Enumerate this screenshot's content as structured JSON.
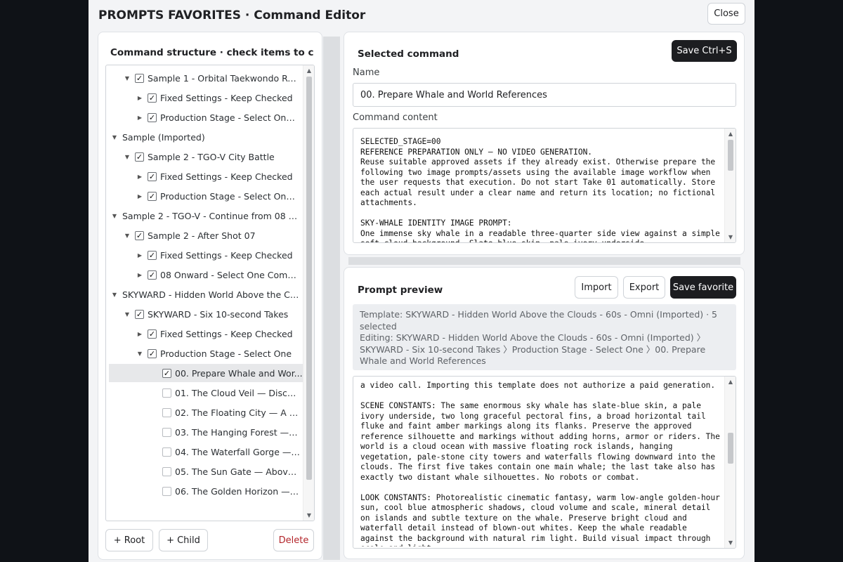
{
  "header": {
    "title": "PROMPTS FAVORITES · Command Editor",
    "close_label": "Close"
  },
  "structure": {
    "title": "Command structure · check items to combine",
    "items": [
      {
        "label": "Sample 1 - Orbital Taekwondo Ro...",
        "depth": 1,
        "caret": "down",
        "checkbox": "checked"
      },
      {
        "label": "Fixed Settings - Keep Checked",
        "depth": 2,
        "caret": "right",
        "checkbox": "checked"
      },
      {
        "label": "Production Stage - Select One,...",
        "depth": 2,
        "caret": "right",
        "checkbox": "checked"
      },
      {
        "label": "Sample (Imported)",
        "depth": 0,
        "caret": "down",
        "checkbox": "none"
      },
      {
        "label": "Sample 2 - TGO-V City Battle",
        "depth": 1,
        "caret": "down",
        "checkbox": "checked"
      },
      {
        "label": "Fixed Settings - Keep Checked",
        "depth": 2,
        "caret": "right",
        "checkbox": "checked"
      },
      {
        "label": "Production Stage - Select One,...",
        "depth": 2,
        "caret": "right",
        "checkbox": "checked"
      },
      {
        "label": "Sample 2 - TGO-V - Continue from 08 (...",
        "depth": 0,
        "caret": "down",
        "checkbox": "none"
      },
      {
        "label": "Sample 2 - After Shot 07",
        "depth": 1,
        "caret": "down",
        "checkbox": "checked"
      },
      {
        "label": "Fixed Settings - Keep Checked",
        "depth": 2,
        "caret": "right",
        "checkbox": "checked"
      },
      {
        "label": "08 Onward - Select One Comp...",
        "depth": 2,
        "caret": "right",
        "checkbox": "checked"
      },
      {
        "label": "SKYWARD - Hidden World Above the Cl...",
        "depth": 0,
        "caret": "down",
        "checkbox": "none"
      },
      {
        "label": "SKYWARD - Six 10-second Takes",
        "depth": 1,
        "caret": "down",
        "checkbox": "checked"
      },
      {
        "label": "Fixed Settings - Keep Checked",
        "depth": 2,
        "caret": "right",
        "checkbox": "checked"
      },
      {
        "label": "Production Stage - Select One",
        "depth": 2,
        "caret": "down",
        "checkbox": "checked"
      },
      {
        "label": "00. Prepare Whale and Wor...",
        "depth": 3,
        "caret": "none",
        "checkbox": "checked",
        "selected": true
      },
      {
        "label": "01. The Cloud Veil — Disco...",
        "depth": 3,
        "caret": "none",
        "checkbox": "unchecked"
      },
      {
        "label": "02. The Floating City — A P...",
        "depth": 3,
        "caret": "none",
        "checkbox": "unchecked"
      },
      {
        "label": "03. The Hanging Forest — ...",
        "depth": 3,
        "caret": "none",
        "checkbox": "unchecked"
      },
      {
        "label": "04. The Waterfall Gorge — ...",
        "depth": 3,
        "caret": "none",
        "checkbox": "unchecked"
      },
      {
        "label": "05. The Sun Gate — Above...",
        "depth": 3,
        "caret": "none",
        "checkbox": "unchecked"
      },
      {
        "label": "06. The Golden Horizon — ...",
        "depth": 3,
        "caret": "none",
        "checkbox": "unchecked"
      }
    ],
    "add_root_label": "+ Root",
    "add_child_label": "+ Child",
    "delete_label": "Delete"
  },
  "selected_command": {
    "title": "Selected command",
    "save_label": "Save  Ctrl+S",
    "name_label": "Name",
    "name_value": "00. Prepare Whale and World References",
    "content_label": "Command content",
    "content": "SELECTED_STAGE=00\nREFERENCE PREPARATION ONLY — NO VIDEO GENERATION.\nReuse suitable approved assets if they already exist. Otherwise prepare the following two image prompts/assets using the available image workflow when the user requests that execution. Do not start Take 01 automatically. Store each actual result under a clear name and return its location; no fictional attachments.\n\nSKY-WHALE IDENTITY IMAGE PROMPT:\nOne immense sky whale in a readable three-quarter side view against a simple soft cloud background. Slate-blue skin, pale ivory underside."
  },
  "preview": {
    "title": "Prompt preview",
    "import_label": "Import",
    "export_label": "Export",
    "save_favorite_label": "Save favorite",
    "template_line": "Template: SKYWARD - Hidden World Above the Clouds - 60s - Omni (Imported) · 5 selected",
    "editing_line": "Editing: SKYWARD - Hidden World Above the Clouds - 60s - Omni (Imported)  〉 SKYWARD - Six 10-second Takes  〉Production Stage - Select One  〉00. Prepare Whale and World References",
    "content": "a video call. Importing this template does not authorize a paid generation.\n\nSCENE CONSTANTS: The same enormous sky whale has slate-blue skin, a pale ivory underside, two long graceful pectoral fins, a broad horizontal tail fluke and faint amber markings along its flanks. Preserve the approved reference silhouette and markings without adding horns, armor or riders. The world is a cloud ocean with massive floating rock islands, hanging vegetation, pale-stone city towers and waterfalls flowing downward into the clouds. The first five takes contain one main whale; the last take also has exactly two distant whale silhouettes. No robots or combat.\n\nLOOK CONSTANTS: Photorealistic cinematic fantasy, warm low-angle golden-hour sun, cool blue atmospheric shadows, cloud volume and scale, mineral detail on islands and subtle texture on the whale. Preserve bright cloud and waterfall detail instead of blown-out whites. Keep the whale readable against the background with natural rim light. Build visual impact through scale and light."
  }
}
